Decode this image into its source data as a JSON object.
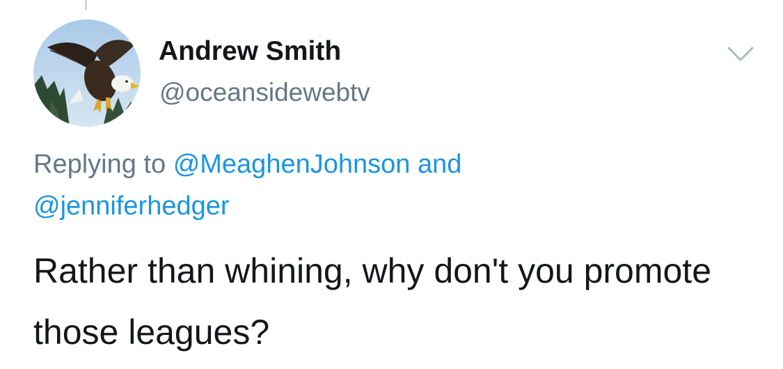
{
  "tweet": {
    "author": {
      "display_name": "Andrew Smith",
      "handle": "@oceansidewebtv",
      "avatar_icon": "bald-eagle-avatar"
    },
    "menu_icon": "chevron-down-icon",
    "reply_prefix": "Replying to",
    "reply_mentions": [
      "@MeaghenJohnson",
      "@jenniferhedger"
    ],
    "reply_conjunction": "and",
    "text": "Rather than whining, why don't you promote those leagues?"
  },
  "colors": {
    "primary_text": "#14171a",
    "secondary_text": "#657786",
    "link": "#1b95e0",
    "background": "#ffffff"
  }
}
